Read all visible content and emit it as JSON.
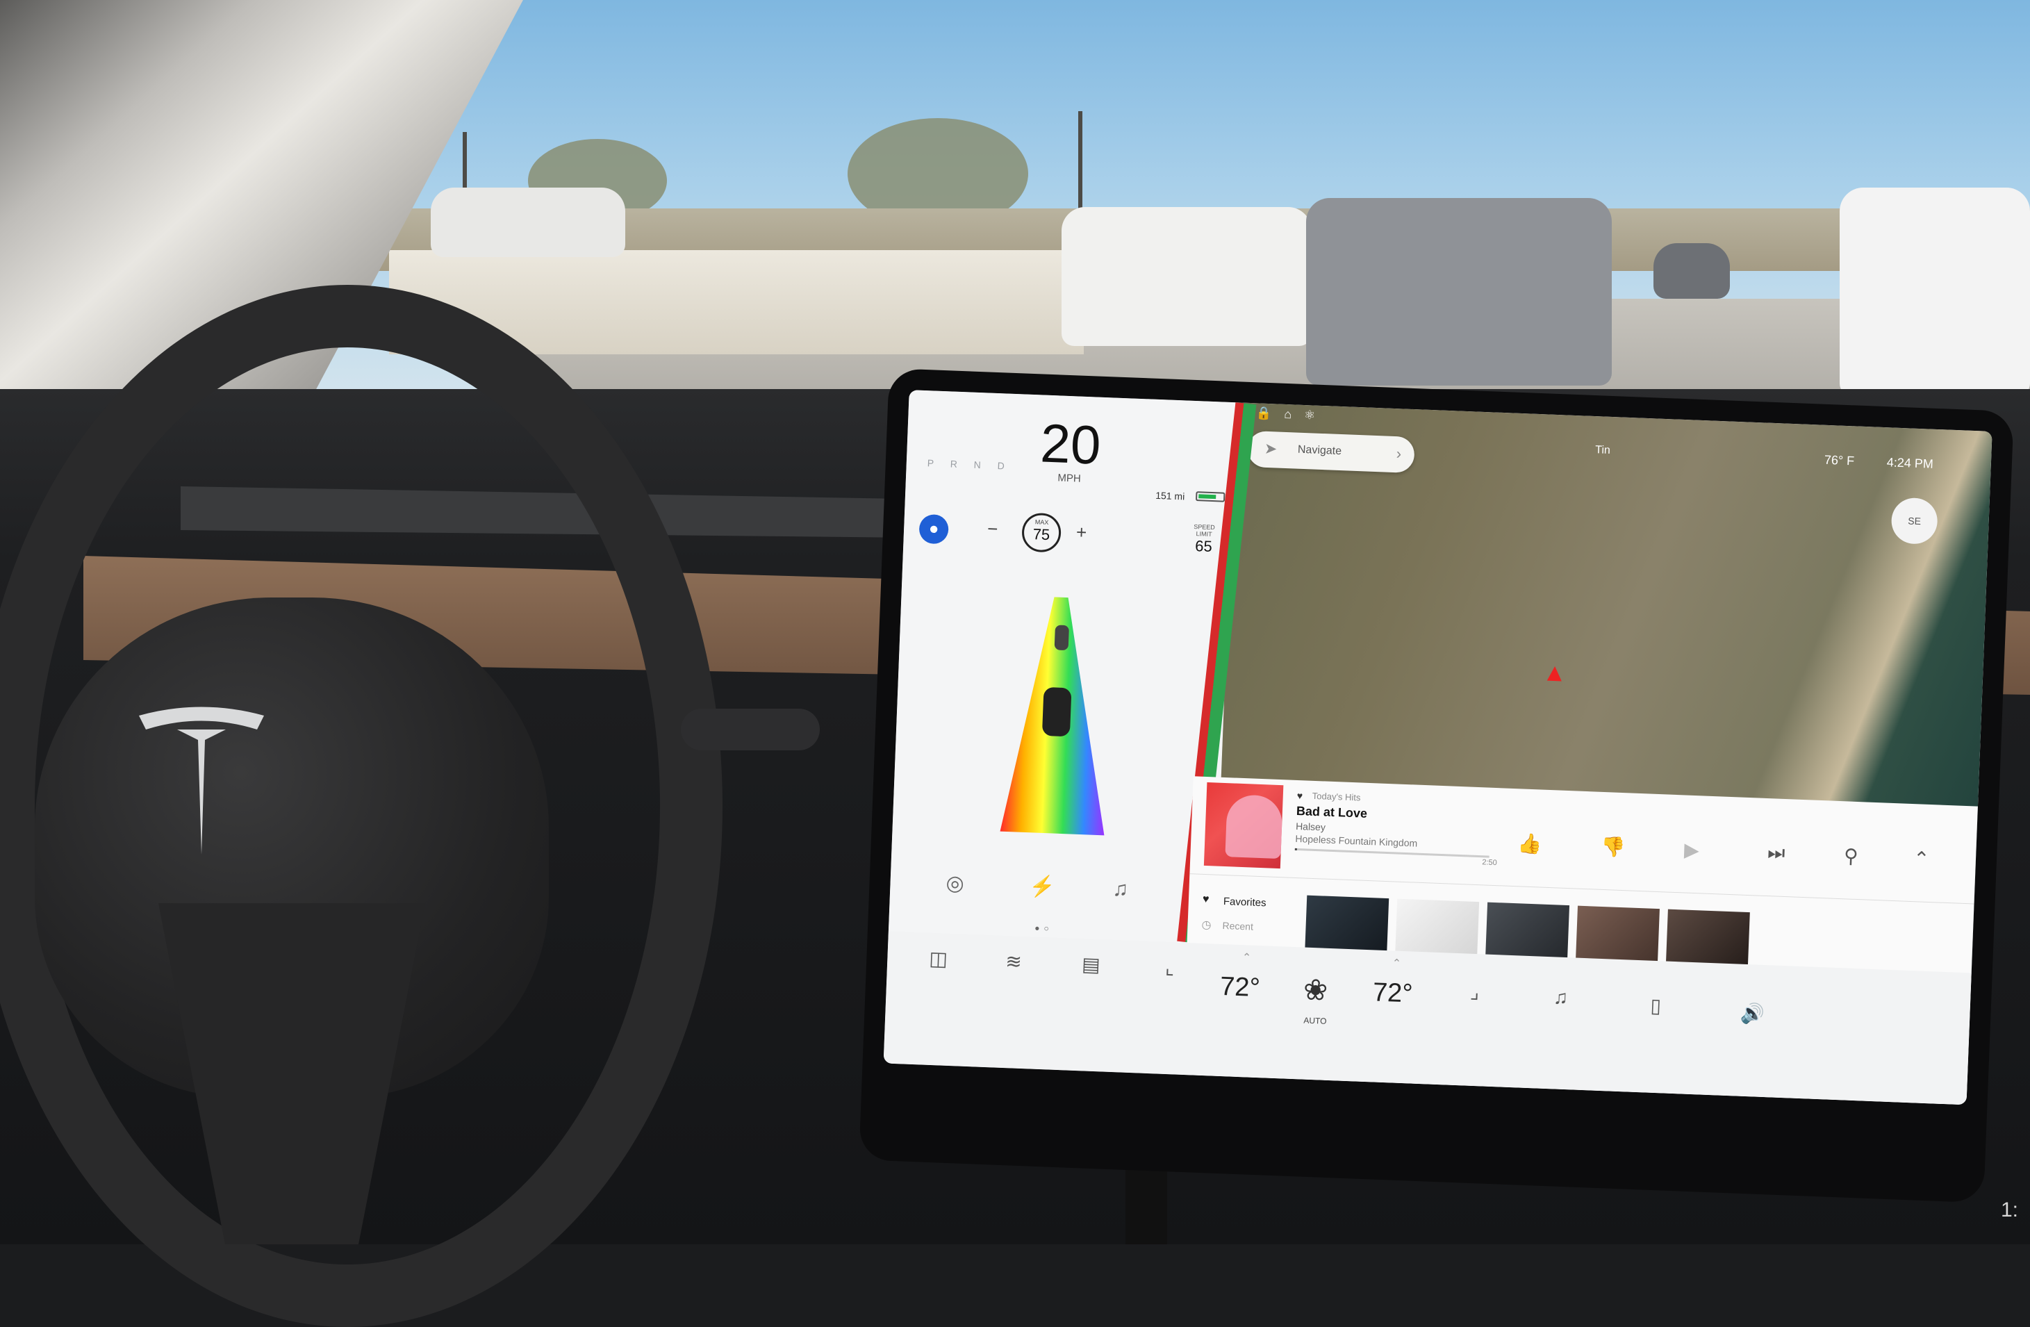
{
  "scene": {
    "description_visible": false
  },
  "cluster": {
    "gears": "P R N D",
    "speed": "20",
    "speed_unit": "MPH",
    "range": "151 mi",
    "battery_level": 0.7,
    "set_speed_label": "MAX",
    "set_speed": "75",
    "limit_label": "SPEED LIMIT",
    "limit": "65",
    "minus": "−",
    "plus": "+",
    "autopilot_icon": "steering-wheel-icon",
    "left_icons": [
      "camera-icon",
      "bolt-icon",
      "mic-icon"
    ]
  },
  "map": {
    "navigate_label": "Navigate",
    "place_label": "Tin",
    "temperature": "76° F",
    "clock": "4:24 PM",
    "compass": "SE",
    "status_icons": [
      "lock-icon",
      "home-icon",
      "bluetooth-icon",
      "lte-icon",
      "tesla-icon"
    ]
  },
  "media": {
    "source": "Today's Hits",
    "title": "Bad at Love",
    "artist": "Halsey",
    "album": "Hopeless Fountain Kingdom",
    "time": "2:50",
    "progress": 0.01,
    "favorites_label": "Favorites",
    "recent_label": "Recent",
    "controls": [
      "thumbs-up-icon",
      "thumbs-down-icon",
      "play-icon",
      "next-icon",
      "search-icon",
      "chevron-up-icon"
    ]
  },
  "climate": {
    "driver_temp": "72°",
    "passenger_temp": "72°",
    "fan_label": "AUTO",
    "icons": [
      "car-icon",
      "defrost-front-icon",
      "defrost-rear-icon",
      "seat-heat-left-icon",
      "fan-icon",
      "seat-heat-right-icon",
      "music-icon",
      "phone-icon",
      "volume-icon"
    ]
  },
  "colors": {
    "autopilot": "#1f5fd6",
    "battery": "#22b14c",
    "route": "#d62a2a",
    "album_art": "#e83a3a"
  }
}
